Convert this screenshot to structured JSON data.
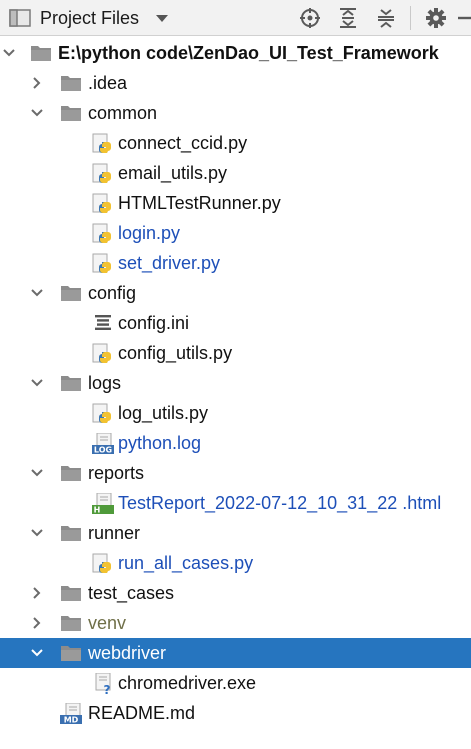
{
  "toolbar": {
    "title": "Project Files",
    "icons": [
      "locate-icon",
      "expand-all-icon",
      "collapse-all-icon",
      "gear-icon",
      "hide-icon"
    ]
  },
  "colors": {
    "selection": "#2675bf",
    "folder": "#8c8c8c",
    "vcs_modified": "#1d4fb8",
    "vcs_added": "#2e7a2e",
    "excluded": "#6f6f48"
  },
  "tree": [
    {
      "label": "E:\\python code\\ZenDao_UI_Test_Framework",
      "depth": 0,
      "type": "folder",
      "expanded": true,
      "style": "root"
    },
    {
      "label": ".idea",
      "depth": 1,
      "type": "folder",
      "expanded": false,
      "style": ""
    },
    {
      "label": "common",
      "depth": 1,
      "type": "folder",
      "expanded": true,
      "style": ""
    },
    {
      "label": "connect_ccid.py",
      "depth": 2,
      "type": "python",
      "style": ""
    },
    {
      "label": "email_utils.py",
      "depth": 2,
      "type": "python",
      "style": ""
    },
    {
      "label": "HTMLTestRunner.py",
      "depth": 2,
      "type": "python",
      "style": ""
    },
    {
      "label": "login.py",
      "depth": 2,
      "type": "python",
      "style": "vcs-blue"
    },
    {
      "label": "set_driver.py",
      "depth": 2,
      "type": "python",
      "style": "vcs-blue"
    },
    {
      "label": "config",
      "depth": 1,
      "type": "folder",
      "expanded": true,
      "style": ""
    },
    {
      "label": "config.ini",
      "depth": 2,
      "type": "ini",
      "style": ""
    },
    {
      "label": "config_utils.py",
      "depth": 2,
      "type": "python",
      "style": ""
    },
    {
      "label": "logs",
      "depth": 1,
      "type": "folder",
      "expanded": true,
      "style": ""
    },
    {
      "label": "log_utils.py",
      "depth": 2,
      "type": "python",
      "style": ""
    },
    {
      "label": "python.log",
      "depth": 2,
      "type": "log",
      "style": "vcs-blue"
    },
    {
      "label": "reports",
      "depth": 1,
      "type": "folder",
      "expanded": true,
      "style": ""
    },
    {
      "label": "TestReport_2022-07-12_10_31_22 .html",
      "depth": 2,
      "type": "html",
      "style": "vcs-blue"
    },
    {
      "label": "runner",
      "depth": 1,
      "type": "folder",
      "expanded": true,
      "style": ""
    },
    {
      "label": "run_all_cases.py",
      "depth": 2,
      "type": "python",
      "style": "vcs-blue"
    },
    {
      "label": "test_cases",
      "depth": 1,
      "type": "folder",
      "expanded": false,
      "style": ""
    },
    {
      "label": "venv",
      "depth": 1,
      "type": "folder",
      "expanded": false,
      "style": "excluded"
    },
    {
      "label": "webdriver",
      "depth": 1,
      "type": "folder",
      "expanded": true,
      "style": "",
      "selected": true
    },
    {
      "label": "chromedriver.exe",
      "depth": 2,
      "type": "unknown",
      "style": ""
    },
    {
      "label": "README.md",
      "depth": 1,
      "type": "markdown",
      "style": ""
    }
  ]
}
